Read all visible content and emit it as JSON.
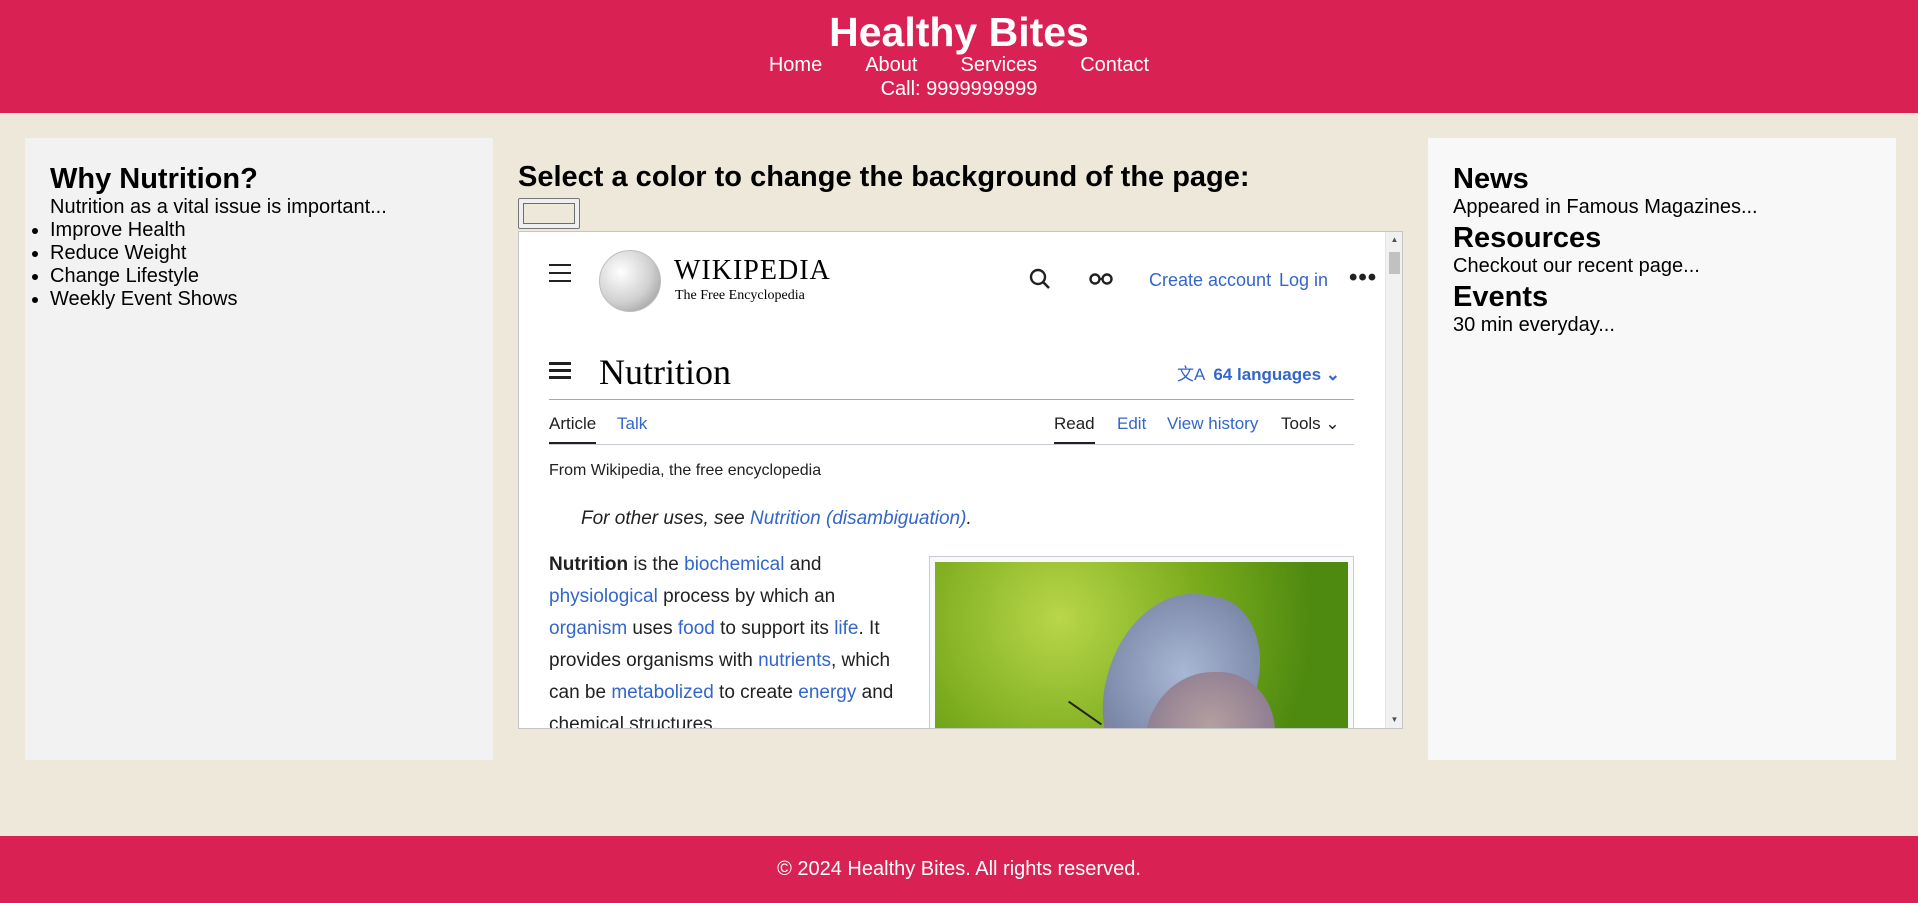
{
  "header": {
    "title": "Healthy Bites",
    "nav": [
      "Home",
      "About",
      "Services",
      "Contact"
    ],
    "call": "Call: 9999999999"
  },
  "left": {
    "heading": "Why Nutrition?",
    "intro": "Nutrition as a vital issue is important...",
    "items": [
      "Improve Health",
      "Reduce Weight",
      "Change Lifestyle",
      "Weekly Event Shows"
    ]
  },
  "center": {
    "heading": "Select a color to change the background of the page:",
    "picker_value": "#ede8d9"
  },
  "wiki": {
    "wordmark": "WIKIPEDIA",
    "tagline": "The Free Encyclopedia",
    "create_account": "Create account",
    "login": "Log in",
    "more": "•••",
    "title": "Nutrition",
    "languages": "64 languages",
    "tabs": {
      "article": "Article",
      "talk": "Talk",
      "read": "Read",
      "edit": "Edit",
      "history": "View history",
      "tools": "Tools"
    },
    "from": "From Wikipedia, the free encyclopedia",
    "hatnote_prefix": "For other uses, see ",
    "hatnote_link": "Nutrition (disambiguation)",
    "hatnote_suffix": ".",
    "body": {
      "t1": "Nutrition",
      "t2": " is the ",
      "l1": "biochemical",
      "t3": " and ",
      "l2": "physiological",
      "t4": " process by which an ",
      "l3": "organism",
      "t5": " uses ",
      "l4": "food",
      "t6": " to support its ",
      "l5": "life",
      "t7": ". It provides organisms with ",
      "l6": "nutrients",
      "t8": ", which can be ",
      "l7": "metabolized",
      "t9": " to create ",
      "l8": "energy",
      "t10": " and chemical structures."
    }
  },
  "right": {
    "news_heading": "News",
    "news_text": "Appeared in Famous Magazines...",
    "resources_heading": "Resources",
    "resources_text": "Checkout our recent page...",
    "events_heading": "Events",
    "events_text": "30 min everyday..."
  },
  "footer": {
    "text": "© 2024 Healthy Bites. All rights reserved."
  },
  "colors": {
    "brand": "#d92253",
    "page_bg": "#ede8d9",
    "link": "#3366cc"
  }
}
